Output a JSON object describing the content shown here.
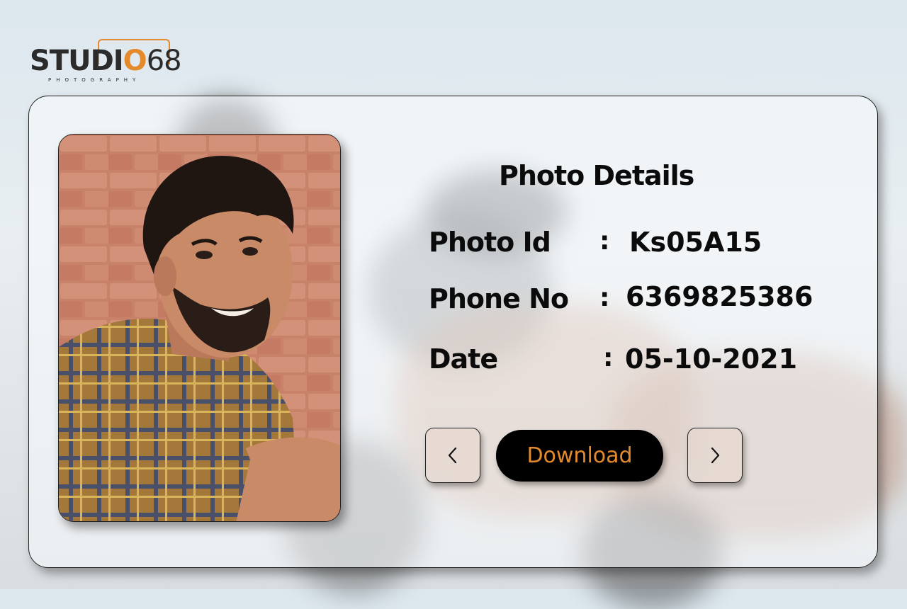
{
  "brand": {
    "part1": "STUDI",
    "part2": "O",
    "part3": "68",
    "tagline": "PHOTOGRAPHY",
    "accent_color": "#e58a2c"
  },
  "details": {
    "title": "Photo Details",
    "fields": [
      {
        "label": "Photo Id",
        "separator": ":",
        "value": "Ks05A15"
      },
      {
        "label": "Phone No",
        "separator": ":",
        "value": "6369825386"
      },
      {
        "label": "Date",
        "separator": ":",
        "value": "05-10-2021"
      }
    ]
  },
  "actions": {
    "download_label": "Download",
    "prev_icon": "chevron-left-icon",
    "next_icon": "chevron-right-icon"
  }
}
